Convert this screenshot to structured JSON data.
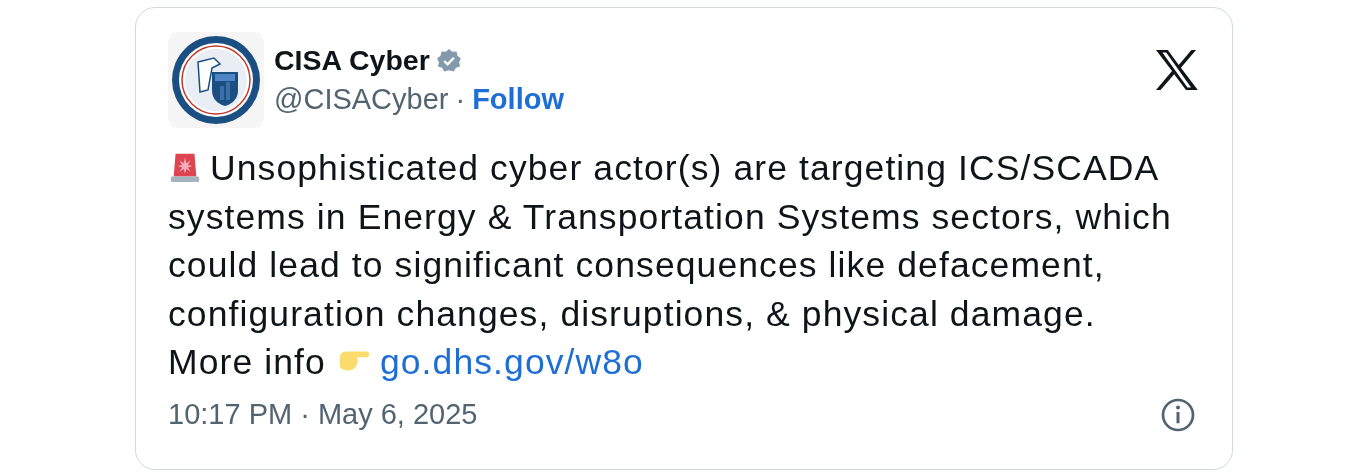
{
  "author": {
    "name": "CISA Cyber",
    "verified": true,
    "handle": "@CISACyber",
    "separator": "·",
    "follow": "Follow"
  },
  "post": {
    "text": "Unsophisticated cyber actor(s) are targeting ICS/SCADA systems in Energy & Transportation Systems sectors, which could lead to significant consequences like defacement, configuration changes, disruptions, & physical damage. More info",
    "link": "go.dhs.gov/w8o"
  },
  "timestamp": "10:17 PM · May 6, 2025"
}
